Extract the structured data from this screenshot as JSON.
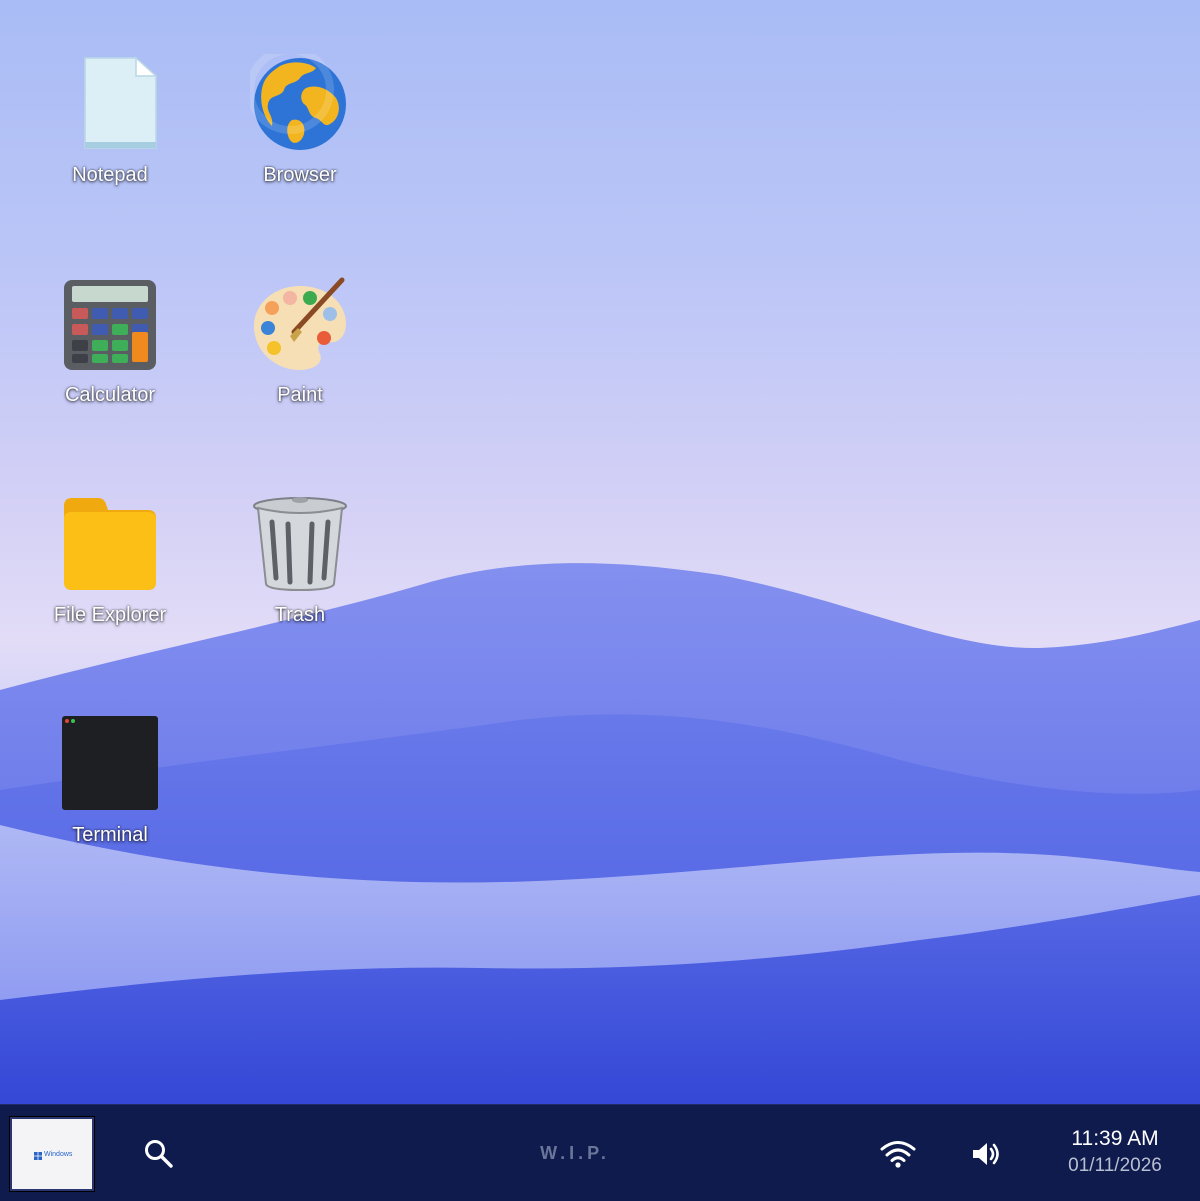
{
  "desktop": {
    "icons": [
      {
        "label": "Notepad",
        "icon": "notepad-icon"
      },
      {
        "label": "Browser",
        "icon": "globe-icon"
      },
      {
        "label": "Calculator",
        "icon": "calculator-icon"
      },
      {
        "label": "Paint",
        "icon": "paint-palette-icon"
      },
      {
        "label": "File Explorer",
        "icon": "folder-icon"
      },
      {
        "label": "Trash",
        "icon": "trash-can-icon"
      },
      {
        "label": "Terminal",
        "icon": "terminal-icon"
      }
    ]
  },
  "taskbar": {
    "start_label": "Windows",
    "search_icon": "search-icon",
    "center_text": "W.I.P.",
    "wifi_icon": "wifi-icon",
    "volume_icon": "volume-icon",
    "time": "11:39 AM",
    "date": "01/11/2026"
  },
  "colors": {
    "taskbar_bg": "#0f1b4d",
    "folder": "#fbbf16",
    "terminal_bg": "#1e1f22"
  }
}
